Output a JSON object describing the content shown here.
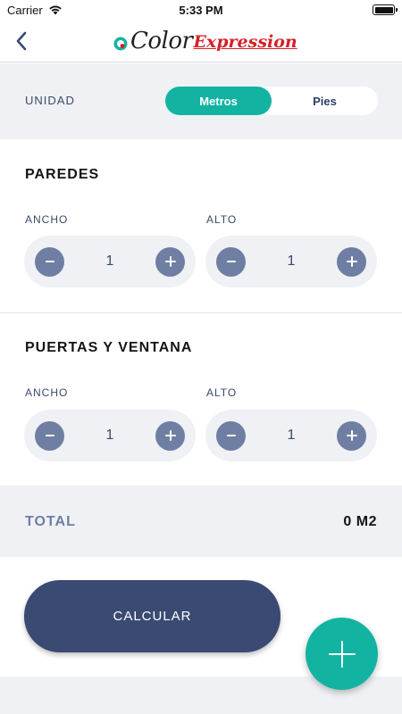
{
  "status_bar": {
    "carrier": "Carrier",
    "time": "5:33 PM"
  },
  "nav": {
    "logo_word1": "Color",
    "logo_word2": "Expression"
  },
  "unit": {
    "label": "UNIDAD",
    "options": [
      "Metros",
      "Pies"
    ],
    "selected": "Metros"
  },
  "walls": {
    "title": "PAREDES",
    "width_label": "ANCHO",
    "width_value": "1",
    "height_label": "ALTO",
    "height_value": "1"
  },
  "doors_windows": {
    "title": "PUERTAS Y VENTANA",
    "width_label": "ANCHO",
    "width_value": "1",
    "height_label": "ALTO",
    "height_value": "1"
  },
  "total": {
    "label": "TOTAL",
    "value": "0 M2"
  },
  "calculate_label": "CALCULAR",
  "colors": {
    "accent": "#13b3a2",
    "primary": "#3a4a72",
    "stepper_button": "#6f7ea3",
    "brand_red": "#d62027"
  },
  "icons": {
    "back": "chevron-left-icon",
    "add": "plus-icon",
    "decrement": "minus-icon",
    "increment": "plus-icon"
  }
}
